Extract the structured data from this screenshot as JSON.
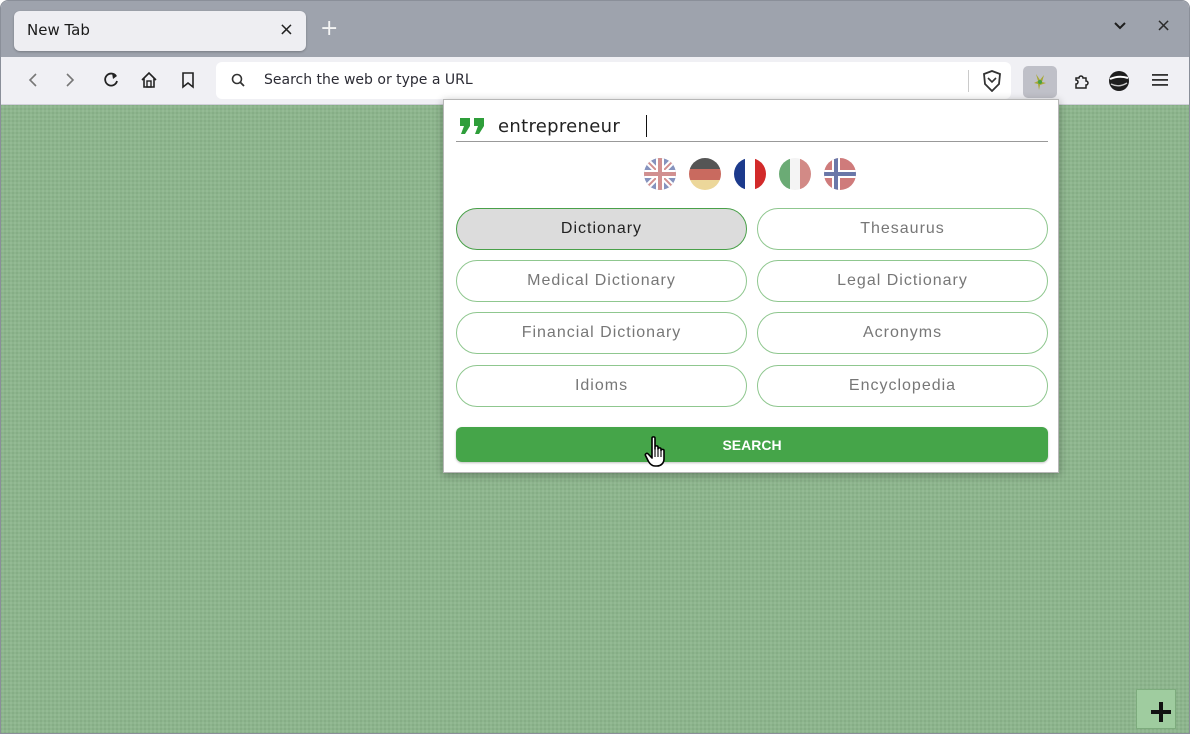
{
  "browser": {
    "tab": {
      "title": "New Tab",
      "close": "×"
    },
    "new_tab": "+",
    "window_close": "×",
    "urlbar": {
      "placeholder": "Search the web or type a URL"
    },
    "icons": [
      "back-icon",
      "forward-icon",
      "reload-icon",
      "home-icon",
      "bookmark-icon",
      "search-icon",
      "brave-shield-icon",
      "extension-icon",
      "puzzle-icon",
      "globe-icon",
      "hamburger-menu-icon"
    ]
  },
  "popup": {
    "query": "entrepreneur",
    "languages": [
      {
        "name": "English",
        "icon": "uk-flag-icon"
      },
      {
        "name": "German",
        "icon": "germany-flag-icon"
      },
      {
        "name": "French",
        "icon": "france-flag-icon"
      },
      {
        "name": "Italian",
        "icon": "italy-flag-icon"
      },
      {
        "name": "Norwegian",
        "icon": "norway-flag-icon"
      }
    ],
    "buttons": [
      {
        "label": "Dictionary",
        "active": true
      },
      {
        "label": "Thesaurus",
        "active": false
      },
      {
        "label": "Medical Dictionary",
        "active": false
      },
      {
        "label": "Legal Dictionary",
        "active": false
      },
      {
        "label": "Financial Dictionary",
        "active": false
      },
      {
        "label": "Acronyms",
        "active": false
      },
      {
        "label": "Idioms",
        "active": false
      },
      {
        "label": "Encyclopedia",
        "active": false
      }
    ],
    "search_label": "SEARCH"
  },
  "content": {
    "add_tile": "+"
  },
  "colors": {
    "accent_green": "#45a549",
    "button_border": "#8fc78f",
    "page_background": "#8db58d",
    "tabstrip": "#9ea3ad"
  }
}
